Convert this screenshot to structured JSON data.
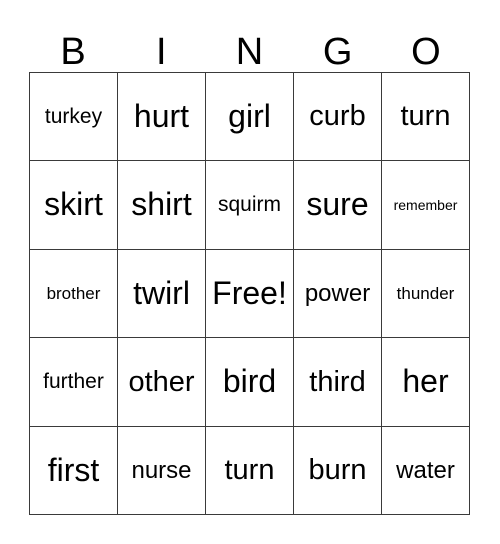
{
  "card": {
    "header": {
      "letters": [
        "B",
        "I",
        "N",
        "G",
        "O"
      ]
    },
    "grid": {
      "columns": 5,
      "rows": 5,
      "rows_data": [
        {
          "cells": [
            {
              "text": "turkey",
              "size": "sm",
              "free": false
            },
            {
              "text": "hurt",
              "size": "xl",
              "free": false
            },
            {
              "text": "girl",
              "size": "xl",
              "free": false
            },
            {
              "text": "curb",
              "size": "lg",
              "free": false
            },
            {
              "text": "turn",
              "size": "lg",
              "free": false
            }
          ]
        },
        {
          "cells": [
            {
              "text": "skirt",
              "size": "xl",
              "free": false
            },
            {
              "text": "shirt",
              "size": "xl",
              "free": false
            },
            {
              "text": "squirm",
              "size": "sm",
              "free": false
            },
            {
              "text": "sure",
              "size": "xl",
              "free": false
            },
            {
              "text": "remember",
              "size": "xxs",
              "free": false
            }
          ]
        },
        {
          "cells": [
            {
              "text": "brother",
              "size": "xs",
              "free": false
            },
            {
              "text": "twirl",
              "size": "xl",
              "free": false
            },
            {
              "text": "Free!",
              "size": "xl",
              "free": true
            },
            {
              "text": "power",
              "size": "md",
              "free": false
            },
            {
              "text": "thunder",
              "size": "xs",
              "free": false
            }
          ]
        },
        {
          "cells": [
            {
              "text": "further",
              "size": "sm",
              "free": false
            },
            {
              "text": "other",
              "size": "lg",
              "free": false
            },
            {
              "text": "bird",
              "size": "xl",
              "free": false
            },
            {
              "text": "third",
              "size": "lg",
              "free": false
            },
            {
              "text": "her",
              "size": "xl",
              "free": false
            }
          ]
        },
        {
          "cells": [
            {
              "text": "first",
              "size": "xl",
              "free": false
            },
            {
              "text": "nurse",
              "size": "md",
              "free": false
            },
            {
              "text": "turn",
              "size": "lg",
              "free": false
            },
            {
              "text": "burn",
              "size": "lg",
              "free": false
            },
            {
              "text": "water",
              "size": "md",
              "free": false
            }
          ]
        }
      ]
    },
    "colors": {
      "background": "#ffffff",
      "border": "#3a3a3a",
      "text": "#000000"
    }
  }
}
